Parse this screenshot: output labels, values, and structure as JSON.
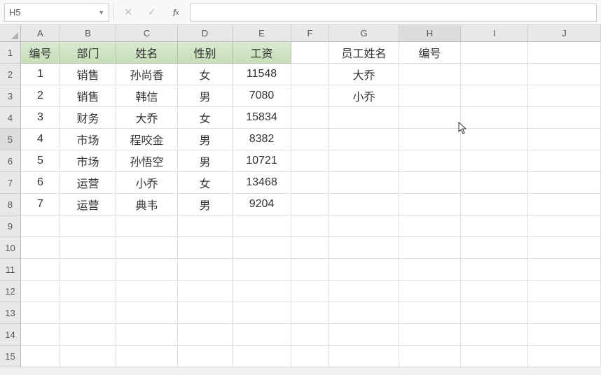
{
  "formula_bar": {
    "name_box": "H5",
    "formula": ""
  },
  "columns": [
    "A",
    "B",
    "C",
    "D",
    "E",
    "F",
    "G",
    "H",
    "I",
    "J"
  ],
  "row_count": 15,
  "header_row": {
    "a": "编号",
    "b": "部门",
    "c": "姓名",
    "d": "性别",
    "e": "工资",
    "g": "员工姓名",
    "h": "编号"
  },
  "data_rows": [
    {
      "a": "1",
      "b": "销售",
      "c": "孙尚香",
      "d": "女",
      "e": "11548",
      "g": "大乔"
    },
    {
      "a": "2",
      "b": "销售",
      "c": "韩信",
      "d": "男",
      "e": "7080",
      "g": "小乔"
    },
    {
      "a": "3",
      "b": "财务",
      "c": "大乔",
      "d": "女",
      "e": "15834"
    },
    {
      "a": "4",
      "b": "市场",
      "c": "程咬金",
      "d": "男",
      "e": "8382"
    },
    {
      "a": "5",
      "b": "市场",
      "c": "孙悟空",
      "d": "男",
      "e": "10721"
    },
    {
      "a": "6",
      "b": "运营",
      "c": "小乔",
      "d": "女",
      "e": "13468"
    },
    {
      "a": "7",
      "b": "运营",
      "c": "典韦",
      "d": "男",
      "e": "9204"
    }
  ],
  "selected_cell": {
    "col": "H",
    "row": 5
  }
}
